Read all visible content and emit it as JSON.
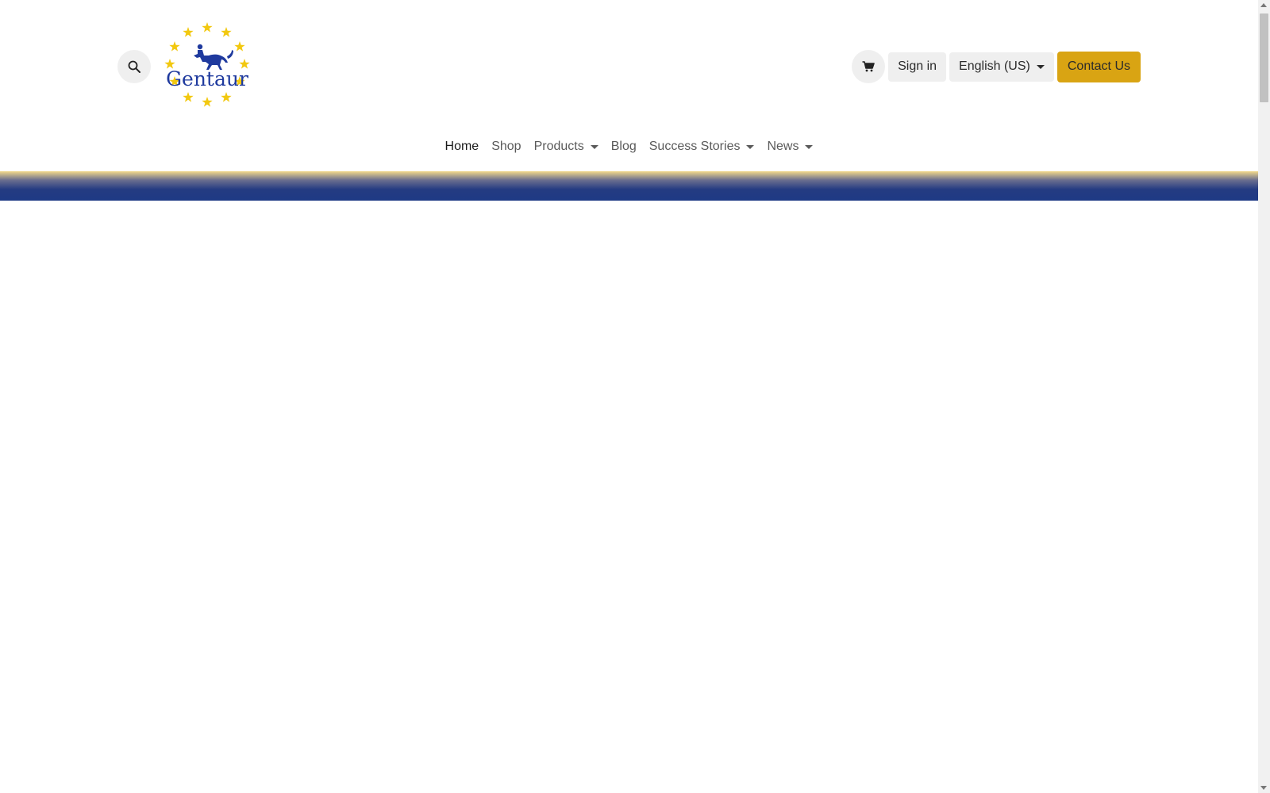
{
  "header": {
    "logo_text": "Gentaur",
    "search_icon": "search-icon",
    "cart_icon": "cart-icon",
    "sign_in_label": "Sign in",
    "language_label": "English (US)",
    "contact_label": "Contact Us"
  },
  "nav": {
    "items": [
      {
        "label": "Home"
      },
      {
        "label": "Shop"
      },
      {
        "label": "Products"
      },
      {
        "label": "Blog"
      },
      {
        "label": "Success Stories"
      },
      {
        "label": "News"
      }
    ]
  },
  "colors": {
    "accent": "#d9a413",
    "brand_blue": "#1f3a9e",
    "star_yellow": "#f2c80f",
    "band_blue": "#1e3a84"
  }
}
